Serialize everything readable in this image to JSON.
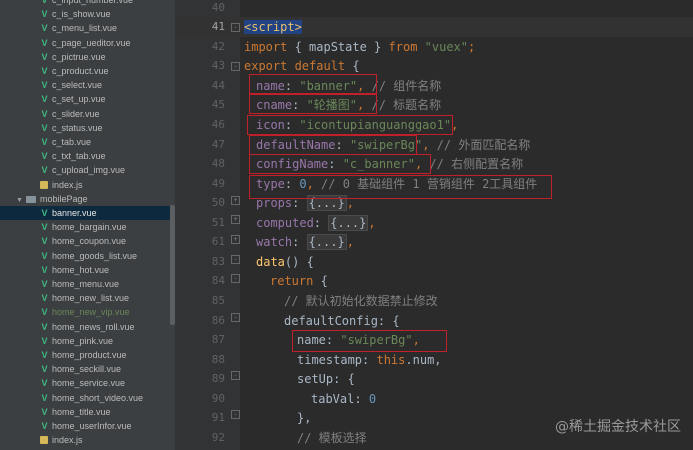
{
  "sidebar": {
    "items": [
      {
        "label": "c_input_number.vue",
        "type": "vue",
        "indent": 1
      },
      {
        "label": "c_is_show.vue",
        "type": "vue",
        "indent": 1
      },
      {
        "label": "c_menu_list.vue",
        "type": "vue",
        "indent": 1
      },
      {
        "label": "c_page_ueditor.vue",
        "type": "vue",
        "indent": 1
      },
      {
        "label": "c_pictrue.vue",
        "type": "vue",
        "indent": 1
      },
      {
        "label": "c_product.vue",
        "type": "vue",
        "indent": 1
      },
      {
        "label": "c_select.vue",
        "type": "vue",
        "indent": 1
      },
      {
        "label": "c_set_up.vue",
        "type": "vue",
        "indent": 1
      },
      {
        "label": "c_slider.vue",
        "type": "vue",
        "indent": 1
      },
      {
        "label": "c_status.vue",
        "type": "vue",
        "indent": 1
      },
      {
        "label": "c_tab.vue",
        "type": "vue",
        "indent": 1
      },
      {
        "label": "c_txt_tab.vue",
        "type": "vue",
        "indent": 1
      },
      {
        "label": "c_upload_img.vue",
        "type": "vue",
        "indent": 1
      },
      {
        "label": "index.js",
        "type": "js",
        "indent": 1
      },
      {
        "label": "mobilePage",
        "type": "folder",
        "indent": 0
      },
      {
        "label": "banner.vue",
        "type": "vue",
        "indent": 1,
        "selected": true
      },
      {
        "label": "home_bargain.vue",
        "type": "vue",
        "indent": 1
      },
      {
        "label": "home_coupon.vue",
        "type": "vue",
        "indent": 1
      },
      {
        "label": "home_goods_list.vue",
        "type": "vue",
        "indent": 1
      },
      {
        "label": "home_hot.vue",
        "type": "vue",
        "indent": 1
      },
      {
        "label": "home_menu.vue",
        "type": "vue",
        "indent": 1
      },
      {
        "label": "home_new_list.vue",
        "type": "vue",
        "indent": 1
      },
      {
        "label": "home_new_vip.vue",
        "type": "vue",
        "indent": 1,
        "highlight": true
      },
      {
        "label": "home_news_roll.vue",
        "type": "vue",
        "indent": 1
      },
      {
        "label": "home_pink.vue",
        "type": "vue",
        "indent": 1
      },
      {
        "label": "home_product.vue",
        "type": "vue",
        "indent": 1
      },
      {
        "label": "home_seckill.vue",
        "type": "vue",
        "indent": 1
      },
      {
        "label": "home_service.vue",
        "type": "vue",
        "indent": 1
      },
      {
        "label": "home_short_video.vue",
        "type": "vue",
        "indent": 1
      },
      {
        "label": "home_title.vue",
        "type": "vue",
        "indent": 1
      },
      {
        "label": "home_userInfor.vue",
        "type": "vue",
        "indent": 1
      },
      {
        "label": "index.js",
        "type": "js",
        "indent": 1
      }
    ]
  },
  "editor": {
    "line_numbers": [
      "40",
      "41",
      "42",
      "43",
      "44",
      "45",
      "46",
      "47",
      "48",
      "49",
      "50",
      "51",
      "61",
      "83",
      "84",
      "85",
      "86",
      "87",
      "88",
      "89",
      "90",
      "91",
      "92"
    ],
    "current_line": "41",
    "code": {
      "l41_tag": "<script>",
      "l42_import": "import",
      "l42_mid": " { mapState } ",
      "l42_from": "from",
      "l42_mod": " \"vuex\"",
      "l42_end": ";",
      "l43_export": "export default",
      "l43_brace": " {",
      "l44_key": "name",
      "l44_val": "\"banner\"",
      "l44_comment": "// 组件名称",
      "l45_key": "cname",
      "l45_val": "\"轮播图\"",
      "l45_comment": "// 标题名称",
      "l46_key": "icon",
      "l46_val": "\"icontupianguanggao1\"",
      "l47_key": "defaultName",
      "l47_val": "\"swiperBg\"",
      "l47_comment": "// 外面匹配名称",
      "l48_key": "configName",
      "l48_val": "\"c_banner\"",
      "l48_comment": "// 右侧配置名称",
      "l49_key": "type",
      "l49_val": "0",
      "l49_comment": "// 0 基础组件 1 营销组件 2工具组件",
      "l50_key": "props",
      "l50_fold": "{...}",
      "l51_key": "computed",
      "l51_fold": "{...}",
      "l61_key": "watch",
      "l61_fold": "{...}",
      "l83_fn": "data",
      "l83_rest": "() {",
      "l84_return": "return",
      "l84_brace": " {",
      "l85_comment": "// 默认初始化数据禁止修改",
      "l86_key": "defaultConfig",
      "l86_rest": ": {",
      "l87_key": "name",
      "l87_val": "\"swiperBg\"",
      "l88_key": "timestamp",
      "l88_this": "this",
      "l88_rest": ".num,",
      "l89_key": "setUp",
      "l89_rest": ": {",
      "l90_key": "tabVal",
      "l90_val": "0",
      "l91_text": "},",
      "l92_comment": "// 模板选择"
    }
  },
  "watermark": "@稀土掘金技术社区",
  "colors": {
    "editor_bg": "#2b2b2b",
    "sidebar_bg": "#3c3f41",
    "keyword": "#cc7832",
    "string": "#6a8759",
    "property": "#9876aa",
    "number": "#6897bb",
    "comment": "#808080",
    "annotation_box": "#c0202a"
  }
}
